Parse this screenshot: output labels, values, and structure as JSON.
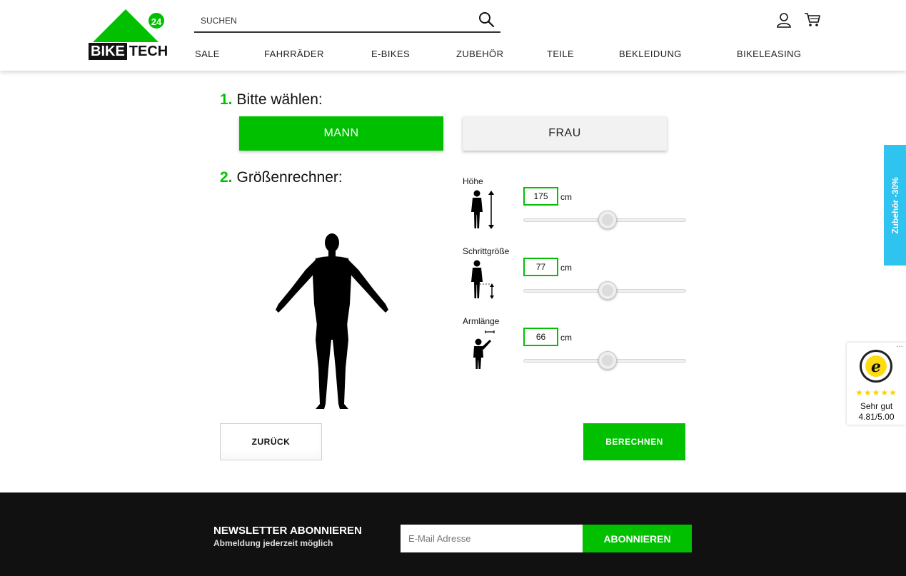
{
  "brand": {
    "logo_badge": "24",
    "logo_word_dark": "BIKE",
    "logo_word_light": "TECH",
    "accent_color": "#00c000"
  },
  "header": {
    "search_placeholder": "SUCHEN",
    "icons": [
      "search-icon",
      "user-icon",
      "cart-icon"
    ],
    "nav": [
      "SALE",
      "FAHRRÄDER",
      "E-BIKES",
      "ZUBEHÖR",
      "TEILE",
      "BEKLEIDUNG",
      "BIKELEASING"
    ]
  },
  "step1": {
    "number": "1.",
    "title": "Bitte wählen:",
    "options": [
      "MANN",
      "FRAU"
    ],
    "selected": "MANN"
  },
  "step2": {
    "number": "2.",
    "title": "Größenrechner:",
    "measurements": [
      {
        "label": "Höhe",
        "value": "175",
        "unit": "cm",
        "slider_fraction": 0.52
      },
      {
        "label": "Schrittgröße",
        "value": "77",
        "unit": "cm",
        "slider_fraction": 0.52
      },
      {
        "label": "Armlänge",
        "value": "66",
        "unit": "cm",
        "slider_fraction": 0.52
      }
    ]
  },
  "actions": {
    "back_label": "ZURÜCK",
    "calculate_label": "BERECHNEN"
  },
  "side_tab": {
    "label": "Zubehör -30%",
    "color": "#2fc3f0"
  },
  "trusted_shops": {
    "stars": "★★★★★",
    "rating_word": "Sehr gut",
    "rating_value": "4.81/5.00",
    "seal_letter": "e"
  },
  "newsletter": {
    "title": "NEWSLETTER ABONNIEREN",
    "subtitle": "Abmeldung jederzeit möglich",
    "email_placeholder": "E-Mail Adresse",
    "button_label": "ABONNIEREN"
  }
}
